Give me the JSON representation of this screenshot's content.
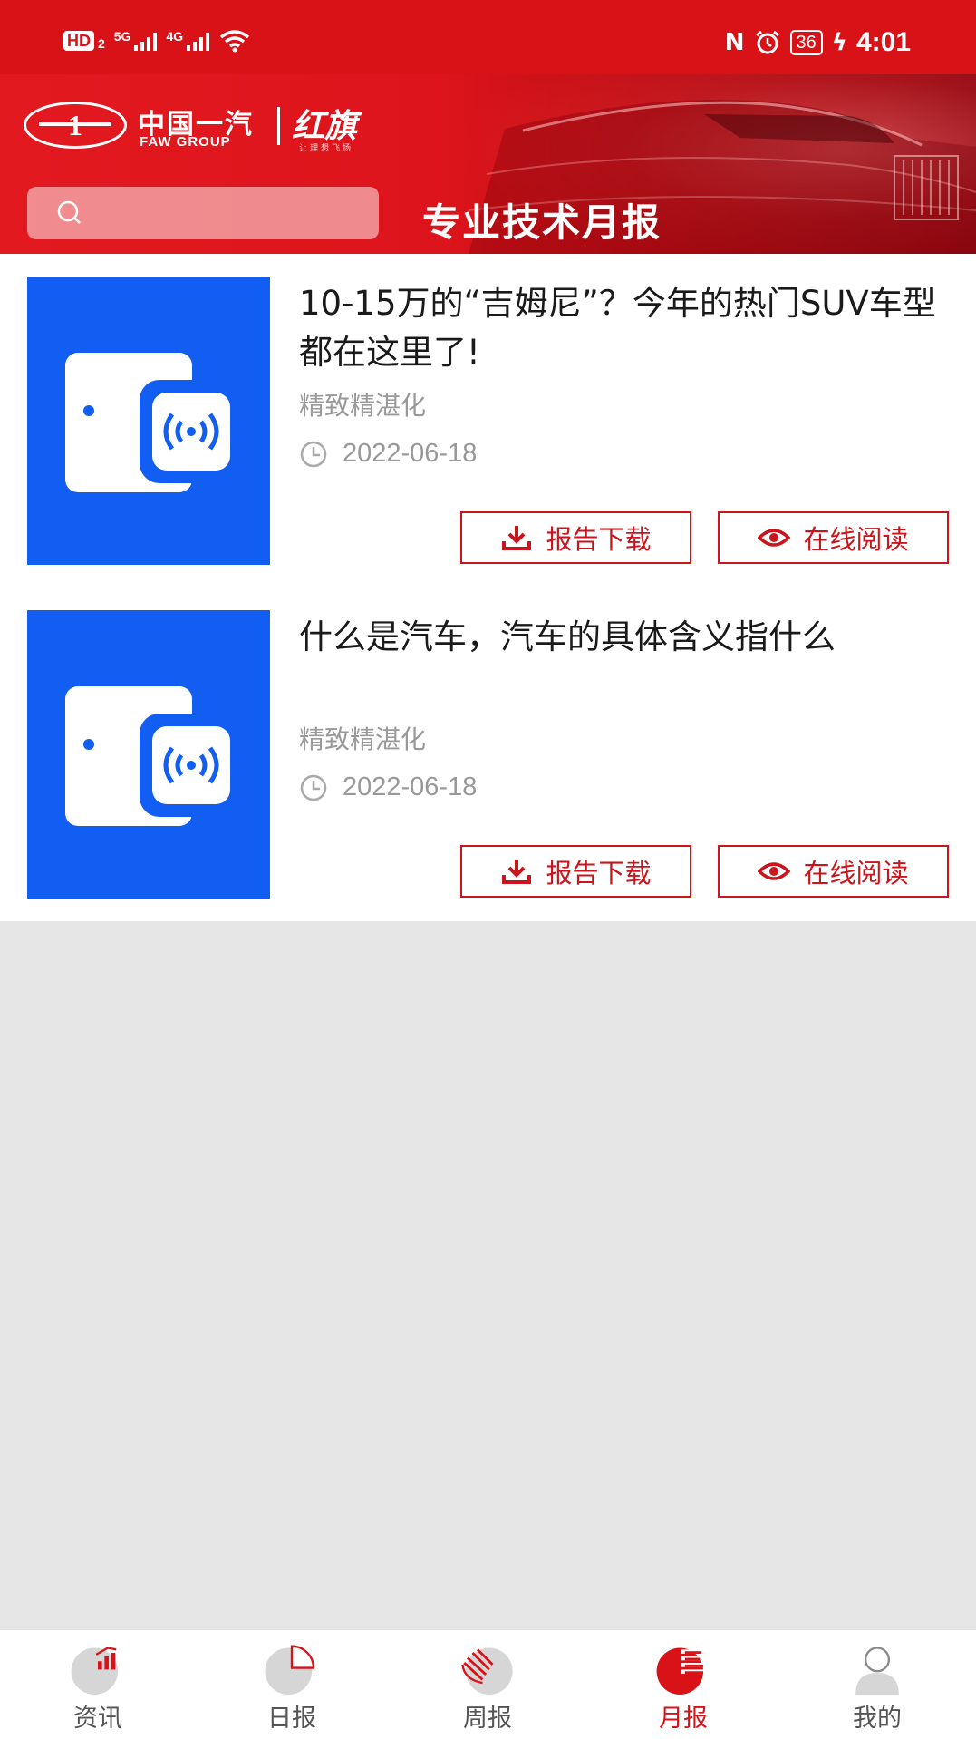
{
  "status_bar": {
    "hd": "HD",
    "sim": "2",
    "net1": "5G",
    "net2": "4G",
    "battery": "36",
    "time": "4:01"
  },
  "header": {
    "logo_cn": "中国一汽",
    "logo_en": "FAW GROUP",
    "brand": "红旗",
    "slogan": "让理想飞扬",
    "search_placeholder": "",
    "page_title": "专业技术月报"
  },
  "articles": [
    {
      "title": "10-15万的“吉姆尼”？今年的热门SUV车型都在这里了!",
      "author": "精致精湛化",
      "date": "2022-06-18",
      "download_label": "报告下载",
      "read_label": "在线阅读"
    },
    {
      "title": "什么是汽车，汽车的具体含义指什么",
      "author": "精致精湛化",
      "date": "2022-06-18",
      "download_label": "报告下载",
      "read_label": "在线阅读"
    }
  ],
  "bottom_nav": [
    {
      "label": "资讯",
      "icon": "news-chart-icon",
      "active": false
    },
    {
      "label": "日报",
      "icon": "daily-pie-icon",
      "active": false
    },
    {
      "label": "周报",
      "icon": "weekly-fan-icon",
      "active": false
    },
    {
      "label": "月报",
      "icon": "monthly-list-icon",
      "active": true
    },
    {
      "label": "我的",
      "icon": "profile-user-icon",
      "active": false
    }
  ],
  "colors": {
    "brand_red": "#d91218",
    "thumb_blue": "#125ef3",
    "button_red": "#c9151b"
  }
}
